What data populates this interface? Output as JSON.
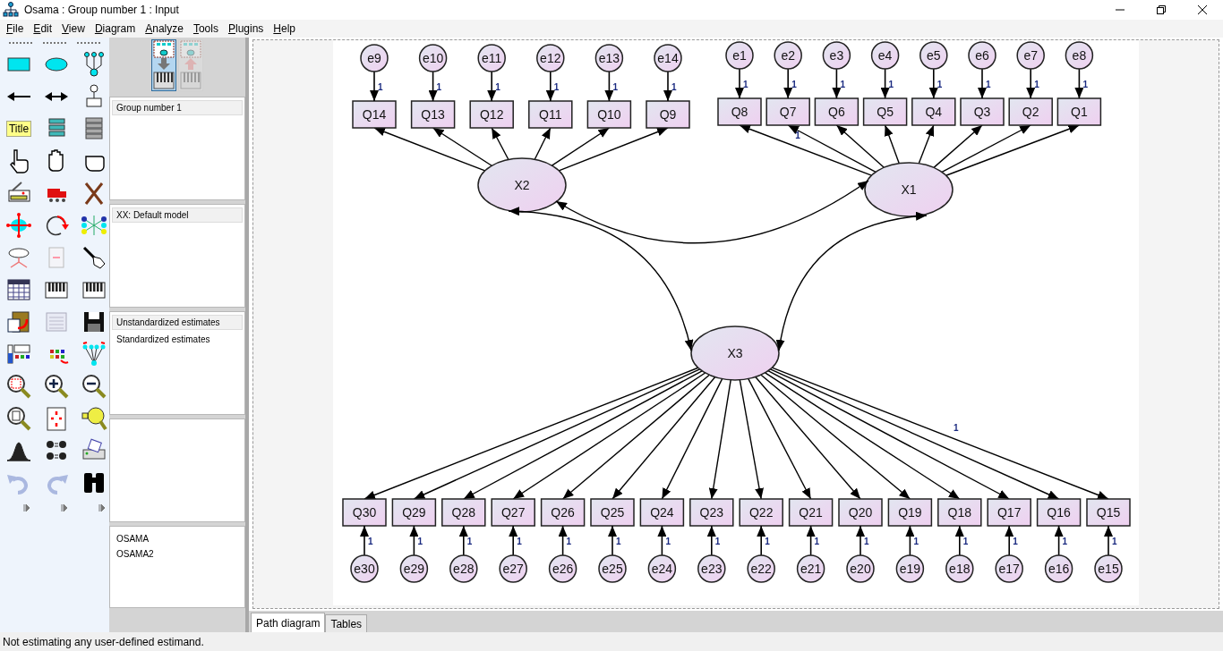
{
  "window": {
    "title": "Osama : Group number 1 : Input"
  },
  "menu": [
    "File",
    "Edit",
    "View",
    "Diagram",
    "Analyze",
    "Tools",
    "Plugins",
    "Help"
  ],
  "toolbox": {
    "title_tool": "Title"
  },
  "view_buttons": [
    {
      "kind": "input",
      "selected": true,
      "disabled": false
    },
    {
      "kind": "output",
      "selected": false,
      "disabled": true
    }
  ],
  "groups": [
    {
      "label": "Group number 1",
      "selected": true
    }
  ],
  "models": [
    {
      "label": "XX: Default model",
      "selected": true
    }
  ],
  "estimates": [
    {
      "label": "Unstandardized estimates",
      "selected": true
    },
    {
      "label": "Standardized estimates",
      "selected": false
    }
  ],
  "files": [
    "OSAMA",
    "OSAMA2"
  ],
  "diagram": {
    "factors": [
      {
        "name": "X2",
        "indicators": [
          {
            "name": "Q14",
            "error": "e9",
            "error_label": "1"
          },
          {
            "name": "Q13",
            "error": "e10",
            "error_label": "1"
          },
          {
            "name": "Q12",
            "error": "e11",
            "error_label": "1"
          },
          {
            "name": "Q11",
            "error": "e12",
            "error_label": "1"
          },
          {
            "name": "Q10",
            "error": "e13",
            "error_label": "1"
          },
          {
            "name": "Q9",
            "error": "e14",
            "error_label": "1"
          }
        ]
      },
      {
        "name": "X1",
        "indicators": [
          {
            "name": "Q8",
            "error": "e1",
            "error_label": "1",
            "loading_label": "1"
          },
          {
            "name": "Q7",
            "error": "e2",
            "error_label": "1"
          },
          {
            "name": "Q6",
            "error": "e3",
            "error_label": "1"
          },
          {
            "name": "Q5",
            "error": "e4",
            "error_label": "1"
          },
          {
            "name": "Q4",
            "error": "e5",
            "error_label": "1"
          },
          {
            "name": "Q3",
            "error": "e6",
            "error_label": "1"
          },
          {
            "name": "Q2",
            "error": "e7",
            "error_label": "1"
          },
          {
            "name": "Q1",
            "error": "e8",
            "error_label": "1"
          }
        ]
      },
      {
        "name": "X3",
        "indicators": [
          {
            "name": "Q30",
            "error": "e30",
            "error_label": "1"
          },
          {
            "name": "Q29",
            "error": "e29",
            "error_label": "1"
          },
          {
            "name": "Q28",
            "error": "e28",
            "error_label": "1"
          },
          {
            "name": "Q27",
            "error": "e27",
            "error_label": "1"
          },
          {
            "name": "Q26",
            "error": "e26",
            "error_label": "1"
          },
          {
            "name": "Q25",
            "error": "e25",
            "error_label": "1"
          },
          {
            "name": "Q24",
            "error": "e24",
            "error_label": "1"
          },
          {
            "name": "Q23",
            "error": "e23",
            "error_label": "1"
          },
          {
            "name": "Q22",
            "error": "e22",
            "error_label": "1"
          },
          {
            "name": "Q21",
            "error": "e21",
            "error_label": "1"
          },
          {
            "name": "Q20",
            "error": "e20",
            "error_label": "1"
          },
          {
            "name": "Q19",
            "error": "e19",
            "error_label": "1"
          },
          {
            "name": "Q18",
            "error": "e18",
            "error_label": "1"
          },
          {
            "name": "Q17",
            "error": "e17",
            "error_label": "1"
          },
          {
            "name": "Q16",
            "error": "e16",
            "error_label": "1"
          },
          {
            "name": "Q15",
            "error": "e15",
            "error_label": "1",
            "loading_label": "1"
          }
        ]
      }
    ]
  },
  "tabs": [
    {
      "label": "Path diagram",
      "selected": true
    },
    {
      "label": "Tables",
      "selected": false
    }
  ],
  "status_bar": "Not estimating any user-defined estimand."
}
